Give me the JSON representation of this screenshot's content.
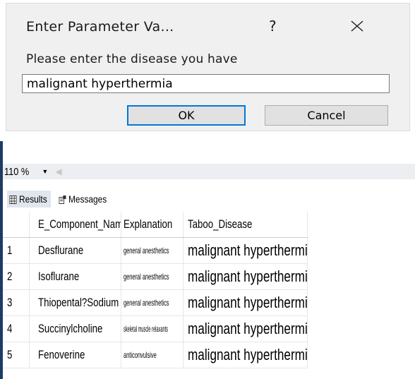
{
  "dialog": {
    "title": "Enter Parameter Va...",
    "help_label": "?",
    "prompt": "Please enter the disease you have",
    "input_value": "malignant hyperthermia",
    "ok_label": "OK",
    "cancel_label": "Cancel"
  },
  "toolbar": {
    "zoom_level": "110 %"
  },
  "tabs": {
    "results_label": "Results",
    "messages_label": "Messages"
  },
  "grid": {
    "columns": [
      "E_Component_Name",
      "Explanation",
      "Taboo_Disease"
    ],
    "rows": [
      {
        "num": "1",
        "name": "Desflurane",
        "explanation": "general anesthetics",
        "taboo": "malignant hyperthermia"
      },
      {
        "num": "2",
        "name": "Isoflurane",
        "explanation": "general anesthetics",
        "taboo": "malignant hyperthermia"
      },
      {
        "num": "3",
        "name": "Thiopental?Sodium",
        "explanation": "general anesthetics",
        "taboo": "malignant hyperthermia"
      },
      {
        "num": "4",
        "name": "Succinylcholine",
        "explanation": "skeletal muscle relaxants",
        "taboo": "malignant hyperthermia"
      },
      {
        "num": "5",
        "name": "Fenoverine",
        "explanation": "anticonvulsive",
        "taboo": "malignant hyperthermia"
      }
    ]
  },
  "colors": {
    "dialog_bg": "#f0f0f0",
    "accent": "#0078d7",
    "button_bg": "#e1e1e1",
    "selected_tab": "#dfe6ee",
    "window_edge": "#1f3a66"
  }
}
